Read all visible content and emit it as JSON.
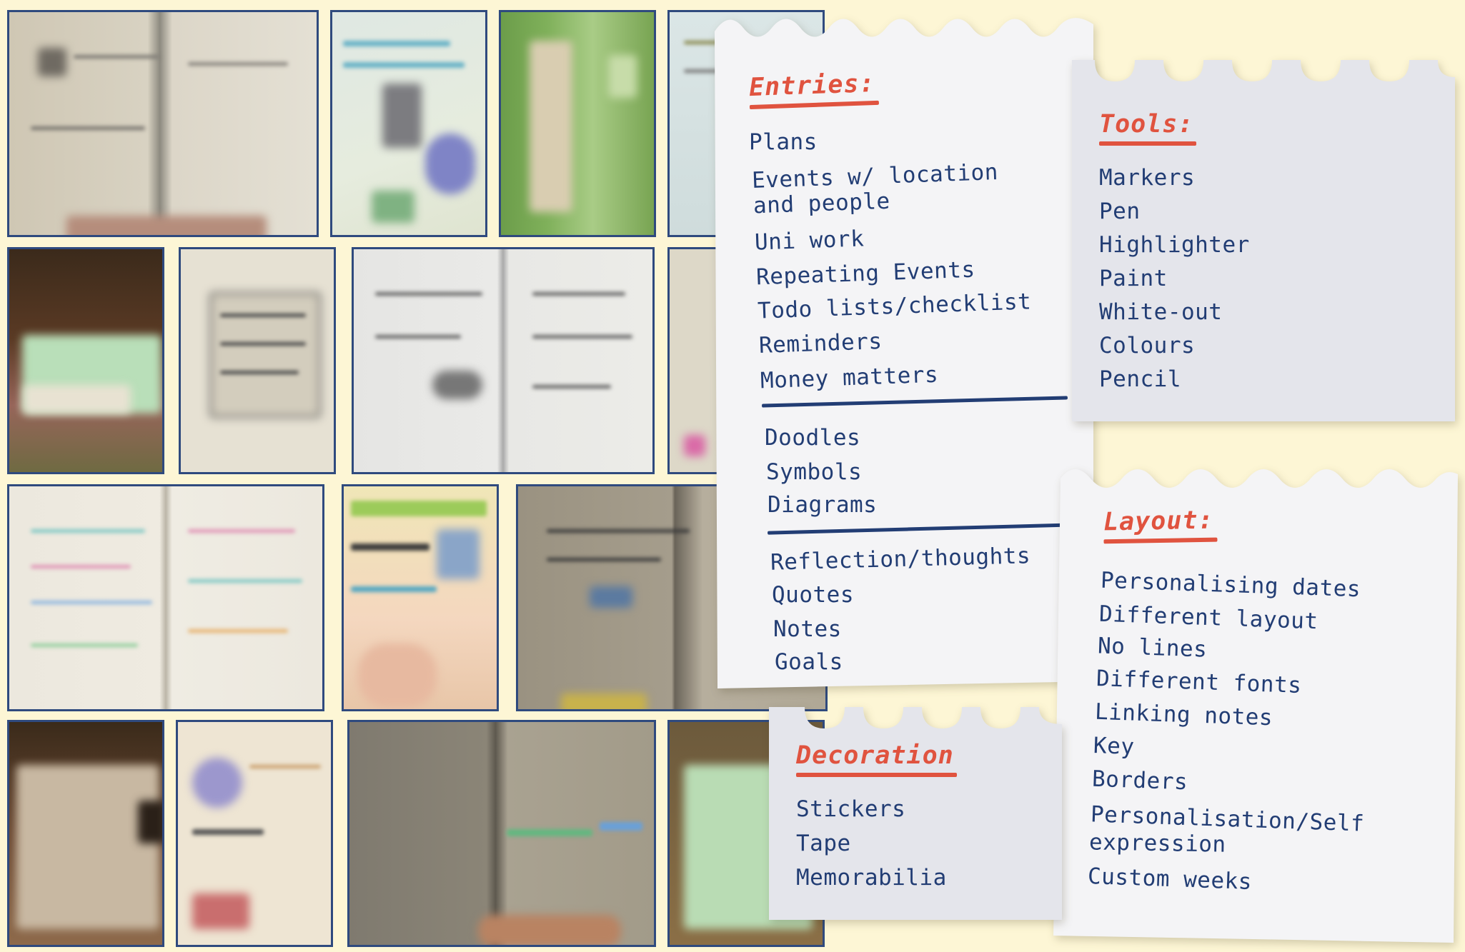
{
  "entries": {
    "heading": "Entries:",
    "group1": [
      "Plans",
      "Events w/ location",
      "and people",
      "Uni work",
      "Repeating Events",
      "Todo lists/checklist",
      "Reminders",
      "Money matters"
    ],
    "group2": [
      "Doodles",
      "Symbols",
      "Diagrams"
    ],
    "group3": [
      "Reflection/thoughts",
      "Quotes",
      "Notes",
      "Goals"
    ]
  },
  "tools": {
    "heading": "Tools:",
    "items": [
      "Markers",
      "Pen",
      "Highlighter",
      "Paint",
      "White-out",
      "Colours",
      "Pencil"
    ]
  },
  "layout": {
    "heading": "Layout:",
    "items": [
      "Personalising dates",
      "Different layout",
      "No lines",
      "Different fonts",
      "Linking notes",
      "Key",
      "Borders",
      "Personalisation/Self",
      "expression",
      "Custom weeks"
    ]
  },
  "decoration": {
    "heading": "Decoration",
    "items": [
      "Stickers",
      "Tape",
      "Memorabilia"
    ]
  },
  "colors": {
    "background": "#fdf6d5",
    "heading_red": "#e0533f",
    "text_navy": "#223d74",
    "photo_border": "#2f4a7e",
    "paper_white": "#f4f4f6",
    "paper_grey": "#e4e5eb"
  }
}
